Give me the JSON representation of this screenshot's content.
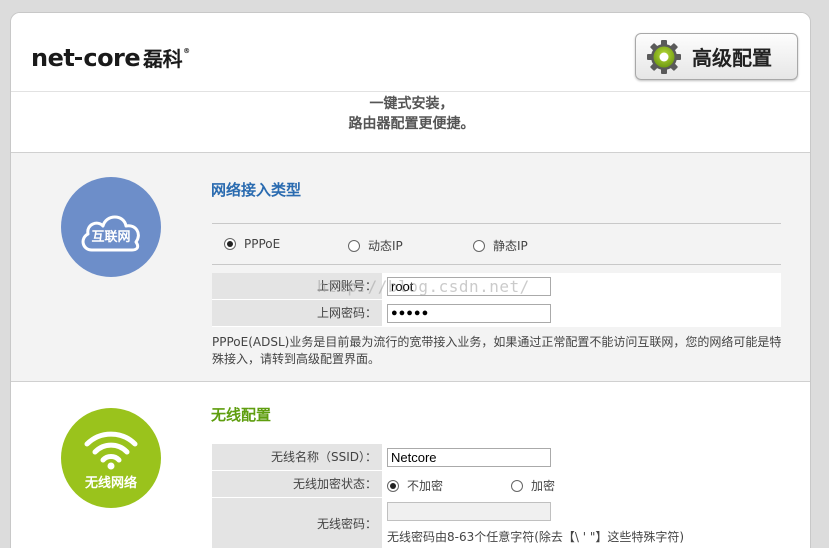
{
  "header": {
    "logo_text_a": "net",
    "logo_text_b": "core",
    "logo_text_cn": "磊科",
    "logo_reg": "®",
    "advanced_button_label": "高级配置"
  },
  "tagline": {
    "line1": "一键式安装，",
    "line2": "路由器配置更便捷。"
  },
  "internet": {
    "icon_label": "互联网",
    "title": "网络接入类型",
    "options": [
      {
        "label": "PPPoE",
        "selected": true
      },
      {
        "label": "动态IP",
        "selected": false
      },
      {
        "label": "静态IP",
        "selected": false
      }
    ],
    "account_label": "上网账号：",
    "account_value": "root",
    "password_label": "上网密码：",
    "password_value": "●●●●●",
    "note": "PPPoE(ADSL)业务是目前最为流行的宽带接入业务，如果通过正常配置不能访问互联网，您的网络可能是特殊接入，请转到高级配置界面。",
    "watermark": "http://blog.csdn.net/"
  },
  "wireless": {
    "icon_label": "无线网络",
    "title": "无线配置",
    "ssid_label": "无线名称（SSID）：",
    "ssid_value": "Netcore",
    "encrypt_label": "无线加密状态：",
    "encrypt_options": [
      {
        "label": "不加密",
        "selected": true
      },
      {
        "label": "加密",
        "selected": false
      }
    ],
    "password_label": "无线密码：",
    "password_value": "",
    "password_hint": "无线密码由8-63个任意字符(除去【\\ ' \"】这些特殊字符)"
  },
  "colors": {
    "internet_circle": "#6d8ec9",
    "wireless_circle": "#9ac31c",
    "internet_title": "#2a6bb0",
    "wireless_title": "#5f9e0f"
  }
}
